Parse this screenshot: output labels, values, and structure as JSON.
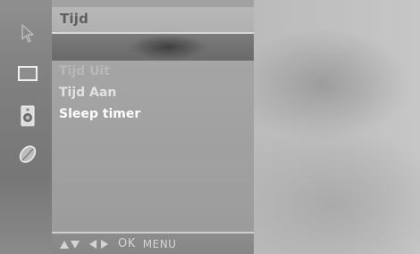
{
  "menu": {
    "title": "Tijd",
    "items": [
      {
        "label": "Tijd Uit"
      },
      {
        "label": "Tijd Aan"
      },
      {
        "label": "Sleep timer"
      }
    ]
  },
  "footer": {
    "ok_label": "OK",
    "menu_label": "MENU"
  },
  "sidebar": {
    "icons": [
      "cursor-icon",
      "screen-icon",
      "speaker-icon",
      "leaf-icon"
    ]
  },
  "colors": {
    "panel": "#a2a2a2",
    "title_bar": "#b7b7b7",
    "selected_text": "#ffffff",
    "strip": "#7c7c7c"
  }
}
